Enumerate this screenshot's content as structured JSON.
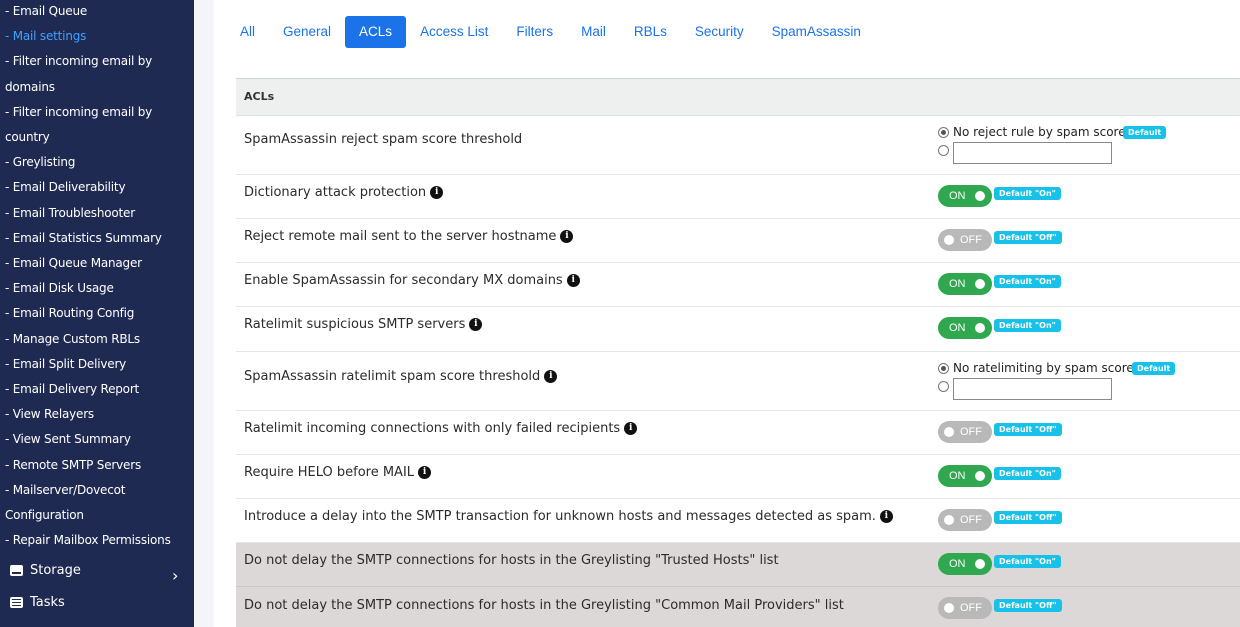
{
  "sidebar": {
    "items": [
      {
        "label": "- Email Queue",
        "active": false
      },
      {
        "label": "- Mail settings",
        "active": true
      },
      {
        "label": "- Filter incoming email by",
        "active": false
      },
      {
        "label": "domains",
        "active": false
      },
      {
        "label": "- Filter incoming email by",
        "active": false
      },
      {
        "label": "country",
        "active": false
      },
      {
        "label": "- Greylisting",
        "active": false
      },
      {
        "label": "- Email Deliverability",
        "active": false
      },
      {
        "label": "- Email Troubleshooter",
        "active": false
      },
      {
        "label": "- Email Statistics Summary",
        "active": false
      },
      {
        "label": "- Email Queue Manager",
        "active": false
      },
      {
        "label": "- Email Disk Usage",
        "active": false
      },
      {
        "label": "- Email Routing Config",
        "active": false
      },
      {
        "label": "- Manage Custom RBLs",
        "active": false
      },
      {
        "label": "- Email Split Delivery",
        "active": false
      },
      {
        "label": "- Email Delivery Report",
        "active": false
      },
      {
        "label": "- View Relayers",
        "active": false
      },
      {
        "label": "- View Sent Summary",
        "active": false
      },
      {
        "label": "- Remote SMTP Servers",
        "active": false
      },
      {
        "label": "- Mailserver/Dovecot",
        "active": false
      },
      {
        "label": "Configuration",
        "active": false
      },
      {
        "label": "- Repair Mailbox Permissions",
        "active": false
      }
    ],
    "sections": [
      {
        "label": "Storage",
        "icon": "storage-icon"
      },
      {
        "label": "Tasks",
        "icon": "tasks-icon"
      }
    ],
    "chevron": "›"
  },
  "tabs": [
    {
      "label": "All",
      "active": false
    },
    {
      "label": "General",
      "active": false
    },
    {
      "label": "ACLs",
      "active": true
    },
    {
      "label": "Access List",
      "active": false
    },
    {
      "label": "Filters",
      "active": false
    },
    {
      "label": "Mail",
      "active": false
    },
    {
      "label": "RBLs",
      "active": false
    },
    {
      "label": "Security",
      "active": false
    },
    {
      "label": "SpamAssassin",
      "active": false
    }
  ],
  "panel": {
    "title": "ACLs",
    "rows": [
      {
        "type": "radio",
        "label": "SpamAssassin reject spam score threshold",
        "info": false,
        "option": "No reject rule by spam score",
        "badge": "Default",
        "value": ""
      },
      {
        "type": "toggle",
        "label": "Dictionary attack protection",
        "info": true,
        "state": "ON",
        "badge": "Default \"On\""
      },
      {
        "type": "toggle",
        "label": "Reject remote mail sent to the server hostname",
        "info": true,
        "state": "OFF",
        "badge": "Default \"Off\""
      },
      {
        "type": "toggle",
        "label": "Enable SpamAssassin for secondary MX domains",
        "info": true,
        "state": "ON",
        "badge": "Default \"On\""
      },
      {
        "type": "toggle",
        "label": "Ratelimit suspicious SMTP servers",
        "info": true,
        "state": "ON",
        "badge": "Default \"On\""
      },
      {
        "type": "radio",
        "label": "SpamAssassin ratelimit spam score threshold",
        "info": true,
        "option": "No ratelimiting by spam score",
        "badge": "Default",
        "value": ""
      },
      {
        "type": "toggle",
        "label": "Ratelimit incoming connections with only failed recipients",
        "info": true,
        "state": "OFF",
        "badge": "Default \"Off\""
      },
      {
        "type": "toggle",
        "label": "Require HELO before MAIL",
        "info": true,
        "state": "ON",
        "badge": "Default \"On\""
      },
      {
        "type": "toggle",
        "label": "Introduce a delay into the SMTP transaction for unknown hosts and messages detected as spam.",
        "info": true,
        "state": "OFF",
        "badge": "Default \"Off\""
      },
      {
        "type": "toggle",
        "label": "Do not delay the SMTP connections for hosts in the Greylisting \"Trusted Hosts\" list",
        "info": false,
        "state": "ON",
        "badge": "Default \"On\"",
        "highlight": true
      },
      {
        "type": "toggle",
        "label": "Do not delay the SMTP connections for hosts in the Greylisting \"Common Mail Providers\" list",
        "info": false,
        "state": "OFF",
        "badge": "Default \"Off\"",
        "highlight": true
      }
    ]
  },
  "colors": {
    "sidebar_bg": "#1f2a52",
    "accent": "#1a73e8",
    "on": "#2fa84f",
    "off": "#b9b9b9",
    "badge": "#17c1e8"
  }
}
